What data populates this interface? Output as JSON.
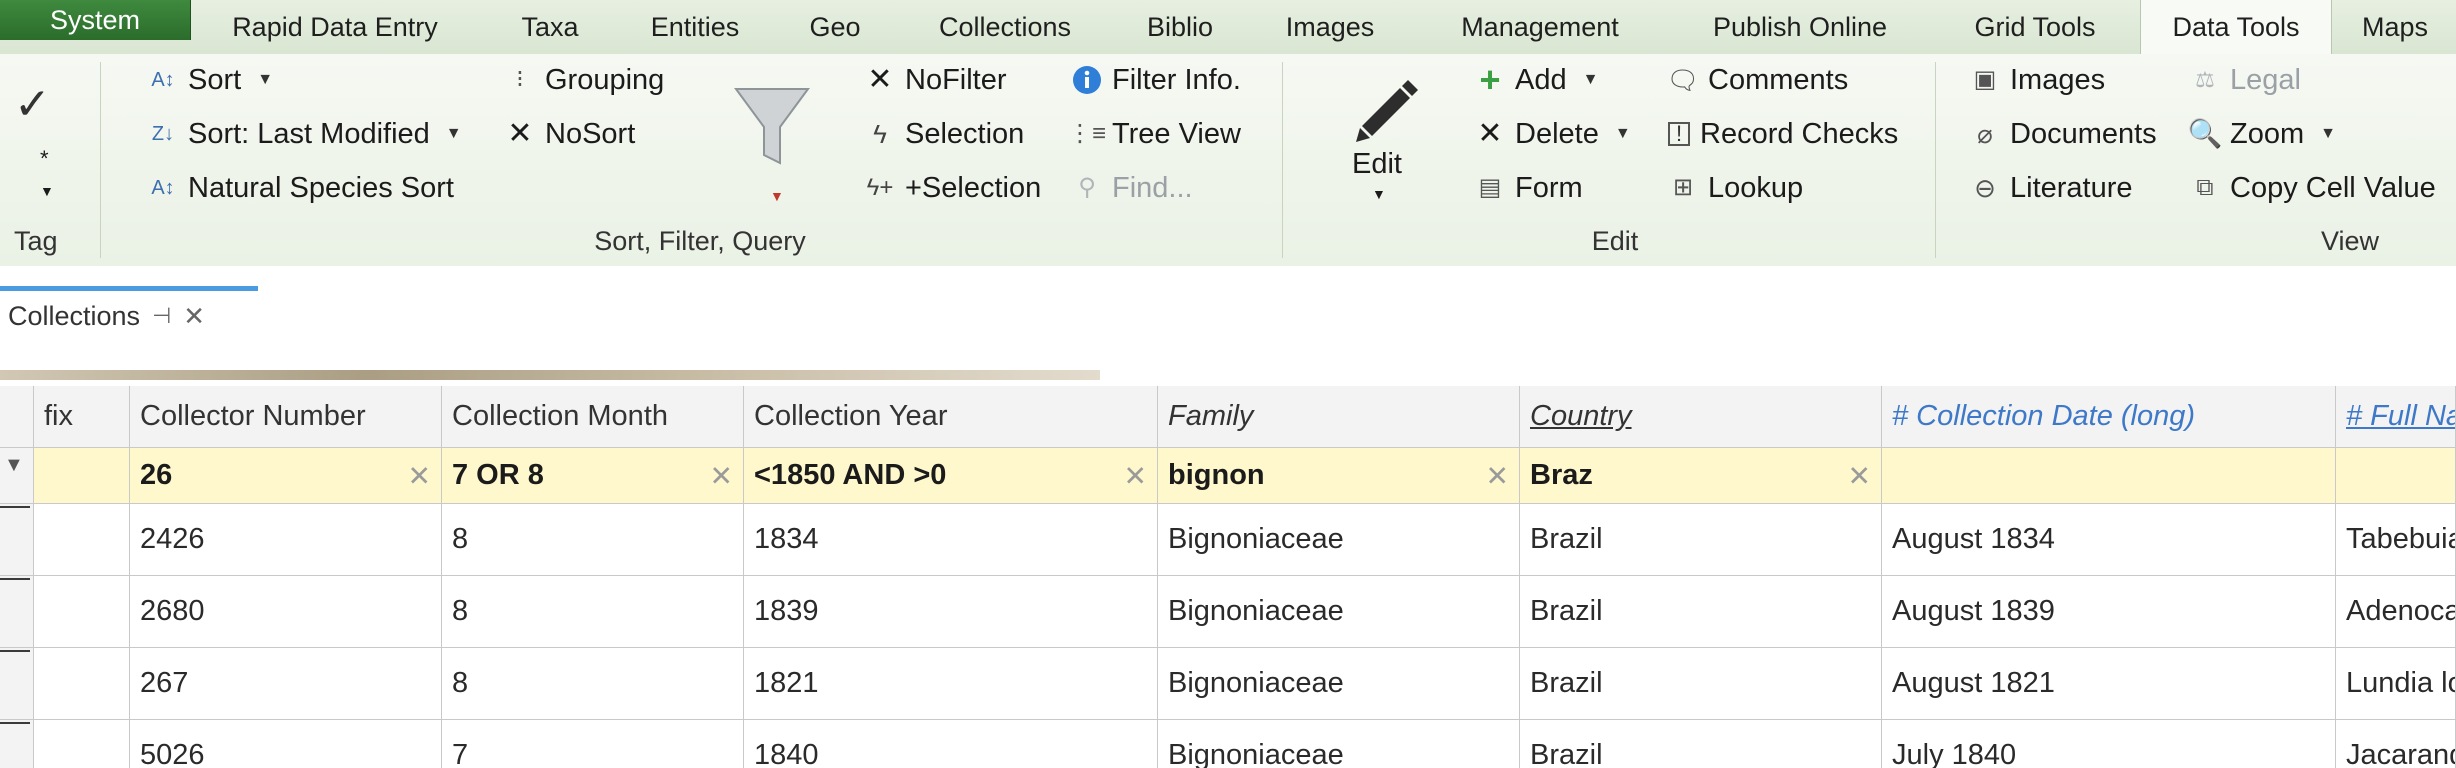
{
  "tabs": [
    {
      "label": "System"
    },
    {
      "label": "Rapid Data Entry"
    },
    {
      "label": "Taxa"
    },
    {
      "label": "Entities"
    },
    {
      "label": "Geo"
    },
    {
      "label": "Collections"
    },
    {
      "label": "Biblio"
    },
    {
      "label": "Images"
    },
    {
      "label": "Management"
    },
    {
      "label": "Publish Online"
    },
    {
      "label": "Grid Tools"
    },
    {
      "label": "Data Tools"
    },
    {
      "label": "Maps"
    }
  ],
  "active_tab": "Data Tools",
  "ribbon": {
    "tag": {
      "check": "✓",
      "star": "*",
      "label": "Tag"
    },
    "sort_filter": {
      "sort": "Sort",
      "sort_last_modified": "Sort: Last Modified",
      "natural_species_sort": "Natural Species Sort",
      "grouping": "Grouping",
      "nosort": "NoSort",
      "nofilter": "NoFilter",
      "selection": "Selection",
      "plus_selection": "+Selection",
      "filter_info": "Filter Info.",
      "tree_view": "Tree View",
      "find": "Find...",
      "label": "Sort, Filter, Query"
    },
    "edit": {
      "edit_big": "Edit",
      "add": "Add",
      "delete": "Delete",
      "form": "Form",
      "comments": "Comments",
      "record_checks": "Record Checks",
      "lookup": "Lookup",
      "label": "Edit"
    },
    "view": {
      "images": "Images",
      "documents": "Documents",
      "literature": "Literature",
      "legal": "Legal",
      "zoom": "Zoom",
      "copy_cell_value": "Copy Cell Value",
      "label": "View"
    }
  },
  "document_tab": {
    "title": "Collections"
  },
  "grid": {
    "columns": [
      {
        "label": "fix"
      },
      {
        "label": "Collector Number"
      },
      {
        "label": "Collection Month"
      },
      {
        "label": "Collection Year"
      },
      {
        "label": "Family"
      },
      {
        "label": "Country"
      },
      {
        "label": "# Collection Date (long)"
      },
      {
        "label": "# Full Na"
      }
    ],
    "filters": [
      "",
      "26",
      "7 OR 8",
      "<1850 AND >0",
      "bignon",
      "Braz",
      "",
      ""
    ],
    "rows": [
      [
        "",
        "2426",
        "8",
        "1834",
        "Bignoniaceae",
        "Brazil",
        "August 1834",
        "Tabebuia"
      ],
      [
        "",
        "2680",
        "8",
        "1839",
        "Bignoniaceae",
        "Brazil",
        "August 1839",
        "Adenoca"
      ],
      [
        "",
        "267",
        "8",
        "1821",
        "Bignoniaceae",
        "Brazil",
        "August 1821",
        "Lundia lo"
      ],
      [
        "",
        "5026",
        "7",
        "1840",
        "Bignoniaceae",
        "Brazil",
        "July 1840",
        "Jacarand"
      ]
    ]
  },
  "colors": {
    "accent": "#2b6c2b",
    "filter_bg": "#fff8cc",
    "header_blue": "#3d79c8",
    "tab_highlight": "#4a9be0"
  }
}
